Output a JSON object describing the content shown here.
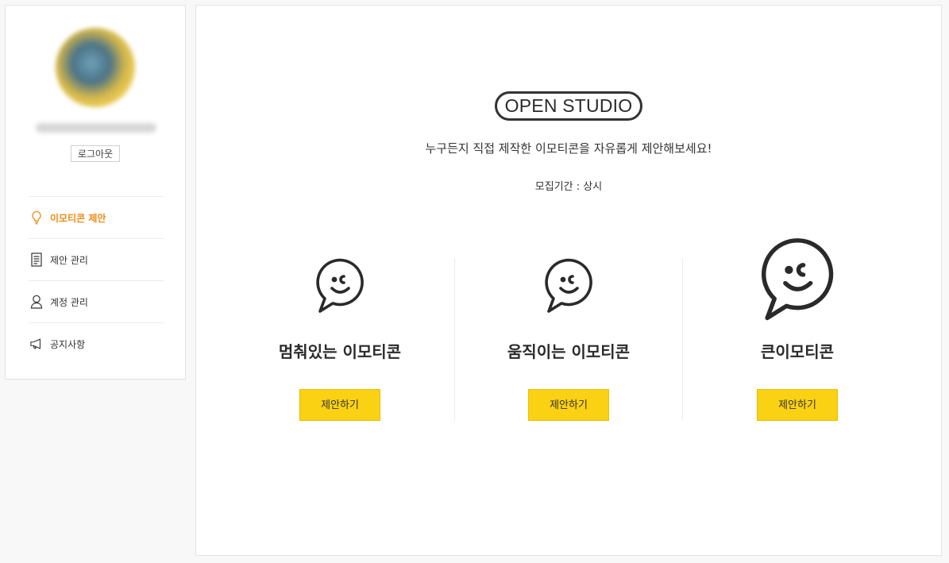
{
  "sidebar": {
    "logout_label": "로그아웃",
    "menu": [
      {
        "label": "이모티콘 제안",
        "icon": "lightbulb-icon",
        "active": true
      },
      {
        "label": "제안 관리",
        "icon": "document-icon",
        "active": false
      },
      {
        "label": "계정 관리",
        "icon": "user-icon",
        "active": false
      },
      {
        "label": "공지사항",
        "icon": "megaphone-icon",
        "active": false
      }
    ]
  },
  "main": {
    "badge": "OPEN STUDIO",
    "subtitle": "누구든지 직접 제작한 이모티콘을 자유롭게 제안해보세요!",
    "period": "모집기간 : 상시",
    "options": [
      {
        "title": "멈춰있는 이모티콘",
        "button": "제안하기",
        "icon": "speech-bubble-face-icon"
      },
      {
        "title": "움직이는 이모티콘",
        "button": "제안하기",
        "icon": "speech-bubble-face-icon"
      },
      {
        "title": "큰이모티콘",
        "button": "제안하기",
        "icon": "large-speech-bubble-face-icon"
      }
    ]
  },
  "colors": {
    "accent": "#f08a14",
    "button_yellow": "#fad113",
    "text": "#222222"
  }
}
